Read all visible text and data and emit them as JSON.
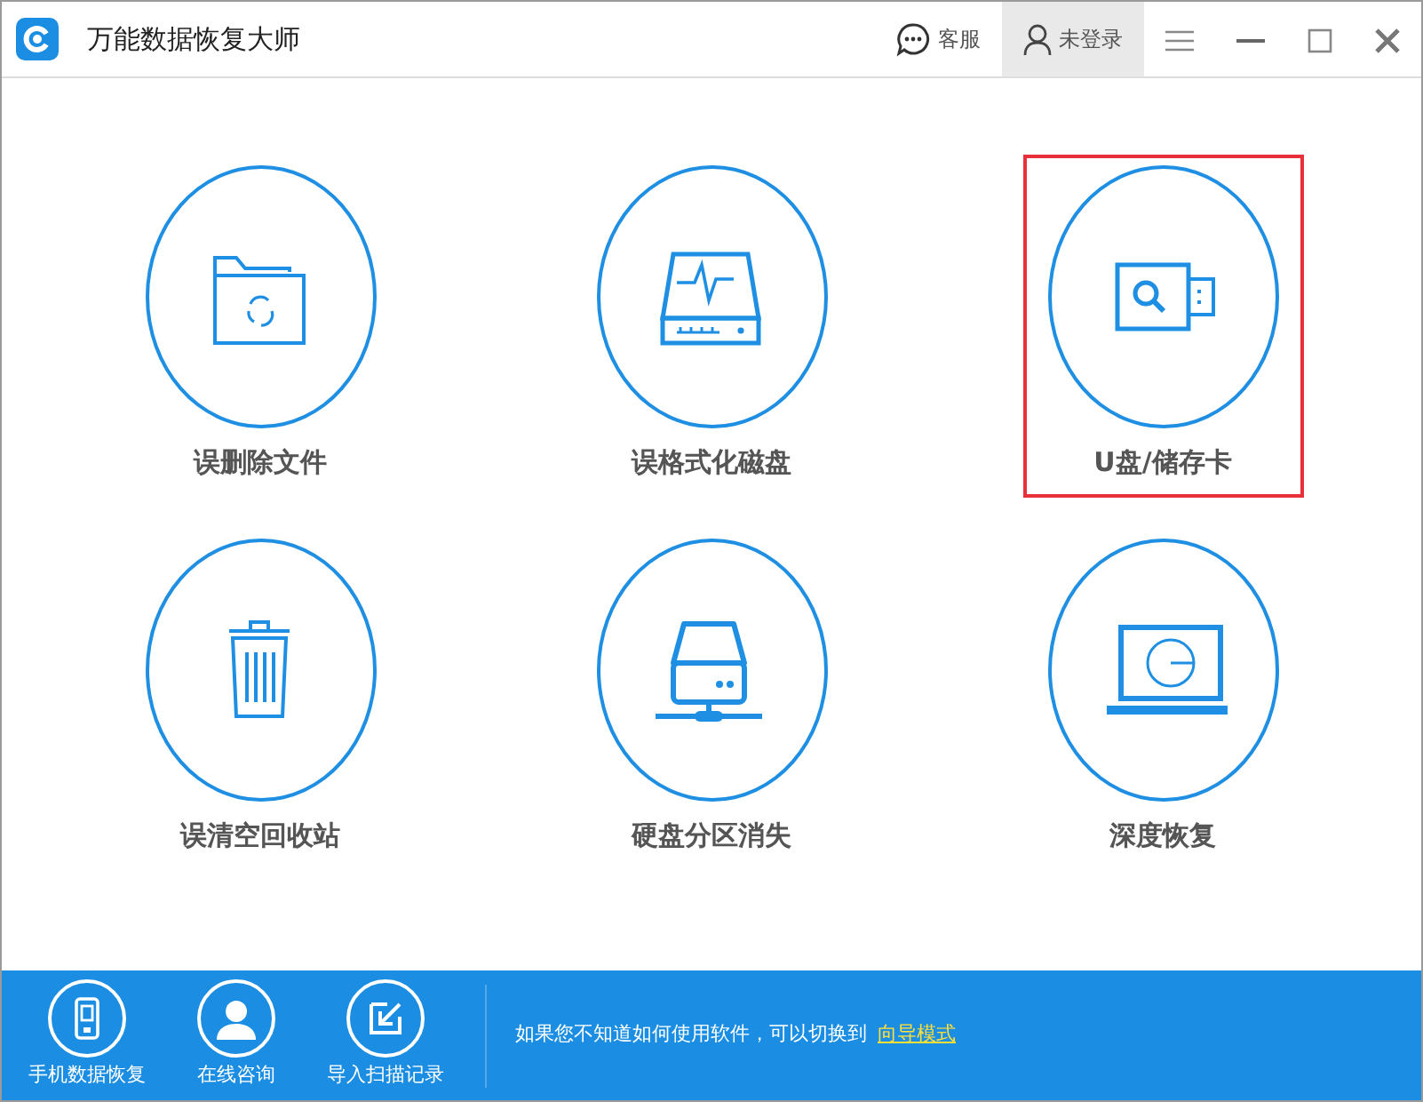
{
  "window": {
    "title": "万能数据恢复大师"
  },
  "title_bar": {
    "support": "客服",
    "login": "未登录"
  },
  "tiles": [
    {
      "kind": "folder",
      "label": "误删除文件",
      "highlighted": false
    },
    {
      "kind": "disk",
      "label": "误格式化磁盘",
      "highlighted": false
    },
    {
      "kind": "usb",
      "label": "U盘/储存卡",
      "highlighted": true
    },
    {
      "kind": "trash",
      "label": "误清空回收站",
      "highlighted": false
    },
    {
      "kind": "server",
      "label": "硬盘分区消失",
      "highlighted": false
    },
    {
      "kind": "laptop",
      "label": "深度恢复",
      "highlighted": false
    }
  ],
  "footer": {
    "buttons": [
      {
        "kind": "phone",
        "label": "手机数据恢复"
      },
      {
        "kind": "person",
        "label": "在线咨询"
      },
      {
        "kind": "import",
        "label": "导入扫描记录"
      }
    ],
    "hint": "如果您不知道如何使用软件，可以切换到",
    "link": "向导模式"
  }
}
